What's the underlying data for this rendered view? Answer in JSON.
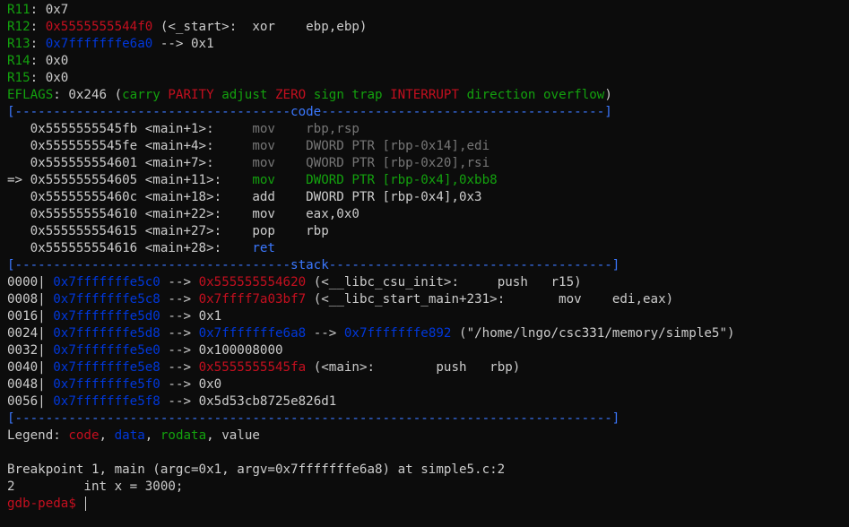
{
  "registers": {
    "r11": {
      "label": "R11",
      "sep": ": ",
      "value": "0x7"
    },
    "r12": {
      "label": "R12",
      "sep": ": ",
      "addr": "0x5555555544f0",
      "rest": " (<_start>:  xor    ebp,ebp)"
    },
    "r13": {
      "label": "R13",
      "sep": ": ",
      "addr": "0x7fffffffe6a0",
      "rest": " --> 0x1"
    },
    "r14": {
      "label": "R14",
      "sep": ": ",
      "value": "0x0"
    },
    "r15": {
      "label": "R15",
      "sep": ": ",
      "value": "0x0"
    }
  },
  "eflags": {
    "label": "EFLAGS",
    "prefix": ": 0x246 (",
    "flags": [
      {
        "text": "carry",
        "set": false
      },
      {
        "text": "PARITY",
        "set": true
      },
      {
        "text": "adjust",
        "set": false
      },
      {
        "text": "ZERO",
        "set": true
      },
      {
        "text": "sign",
        "set": false
      },
      {
        "text": "trap",
        "set": false
      },
      {
        "text": "INTERRUPT",
        "set": true
      },
      {
        "text": "direction",
        "set": false
      },
      {
        "text": "overflow",
        "set": false
      }
    ],
    "suffix": ")"
  },
  "code_header": {
    "left": "[------------------------------------",
    "title": "code",
    "right": "-------------------------------------]"
  },
  "code": [
    {
      "marker": "   ",
      "addr": "0x5555555545fb",
      "sym": " <main+1>:     ",
      "op": "mov",
      "pad": "    ",
      "args": "rbp,rsp",
      "state": "past"
    },
    {
      "marker": "   ",
      "addr": "0x5555555545fe",
      "sym": " <main+4>:     ",
      "op": "mov",
      "pad": "    ",
      "args": "DWORD PTR [rbp-0x14],edi",
      "state": "past"
    },
    {
      "marker": "   ",
      "addr": "0x555555554601",
      "sym": " <main+7>:     ",
      "op": "mov",
      "pad": "    ",
      "args": "QWORD PTR [rbp-0x20],rsi",
      "state": "past"
    },
    {
      "marker": "=> ",
      "addr": "0x555555554605",
      "sym": " <main+11>:    ",
      "op": "mov",
      "pad": "    ",
      "args": "DWORD PTR [rbp-0x4],0xbb8",
      "state": "current"
    },
    {
      "marker": "   ",
      "addr": "0x55555555460c",
      "sym": " <main+18>:    ",
      "op": "add",
      "pad": "    ",
      "args": "DWORD PTR [rbp-0x4],0x3",
      "state": "next"
    },
    {
      "marker": "   ",
      "addr": "0x555555554610",
      "sym": " <main+22>:    ",
      "op": "mov",
      "pad": "    ",
      "args": "eax,0x0",
      "state": "next"
    },
    {
      "marker": "   ",
      "addr": "0x555555554615",
      "sym": " <main+27>:    ",
      "op": "pop",
      "pad": "    ",
      "args": "rbp",
      "state": "next"
    },
    {
      "marker": "   ",
      "addr": "0x555555554616",
      "sym": " <main+28>:    ",
      "op": "ret",
      "pad": "",
      "args": "",
      "state": "ret"
    }
  ],
  "stack_header": {
    "left": "[------------------------------------",
    "title": "stack",
    "right": "-------------------------------------]"
  },
  "stack": [
    {
      "off": "0000",
      "addr": "0x7fffffffe5c0",
      "arrow": " --> ",
      "val": "0x555555554620",
      "valtype": "code",
      "rest": " (<__libc_csu_init>:     push   r15)"
    },
    {
      "off": "0008",
      "addr": "0x7fffffffe5c8",
      "arrow": " --> ",
      "val": "0x7ffff7a03bf7",
      "valtype": "code",
      "rest": " (<__libc_start_main+231>:       mov    edi,eax)"
    },
    {
      "off": "0016",
      "addr": "0x7fffffffe5d0",
      "arrow": " --> ",
      "val": "0x1",
      "valtype": "value",
      "rest": ""
    },
    {
      "off": "0024",
      "addr": "0x7fffffffe5d8",
      "arrow": " --> ",
      "val": "0x7fffffffe6a8",
      "valtype": "data",
      "rest": " --> ",
      "val2": "0x7fffffffe892",
      "rest2": " (\"/home/lngo/csc331/memory/simple5\")"
    },
    {
      "off": "0032",
      "addr": "0x7fffffffe5e0",
      "arrow": " --> ",
      "val": "0x100008000",
      "valtype": "value",
      "rest": ""
    },
    {
      "off": "0040",
      "addr": "0x7fffffffe5e8",
      "arrow": " --> ",
      "val": "0x5555555545fa",
      "valtype": "code",
      "rest": " (<main>:        push   rbp)"
    },
    {
      "off": "0048",
      "addr": "0x7fffffffe5f0",
      "arrow": " --> ",
      "val": "0x0",
      "valtype": "value",
      "rest": ""
    },
    {
      "off": "0056",
      "addr": "0x7fffffffe5f8",
      "arrow": " --> ",
      "val": "0x5d53cb8725e826d1",
      "valtype": "value",
      "rest": ""
    }
  ],
  "footer_rule": "[------------------------------------------------------------------------------]",
  "legend": {
    "prefix": "Legend: ",
    "code": "code",
    "sep1": ", ",
    "data": "data",
    "sep2": ", ",
    "rodata": "rodata",
    "sep3": ", ",
    "value": "value"
  },
  "breakpoint": "Breakpoint 1, main (argc=0x1, argv=0x7fffffffe6a8) at simple5.c:2",
  "source_line": "2         int x = 3000;",
  "prompt": "gdb-peda$ ",
  "colors": {
    "background": "#0c0c0c",
    "text": "#cccccc",
    "green": "#13a10e",
    "red": "#c50f1f",
    "blue": "#0037da",
    "light_blue": "#3b78ff",
    "gray": "#767676"
  }
}
